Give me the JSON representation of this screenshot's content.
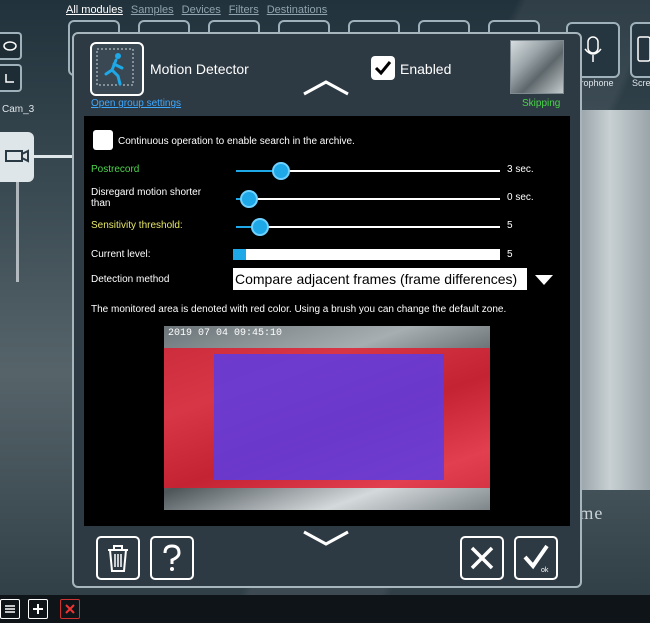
{
  "top_nav": [
    {
      "label": "All modules",
      "active": true
    },
    {
      "label": "Samples",
      "active": false
    },
    {
      "label": "Devices",
      "active": false
    },
    {
      "label": "Filters",
      "active": false
    },
    {
      "label": "Destinations",
      "active": false
    }
  ],
  "background": {
    "camera_label": "Cam_3",
    "right_tile_labels": [
      "icrophone",
      "Scre"
    ],
    "watermark": "IP   Z Came"
  },
  "dialog": {
    "title": "Motion Detector",
    "group_link": "Open group settings",
    "enabled_label": "Enabled",
    "enabled": true,
    "preview_status": "Skipping",
    "continuous_label": "Continuous operation to enable search in the archive.",
    "continuous_checked": false,
    "postrecord": {
      "label": "Postrecord",
      "value_text": "3 sec.",
      "fraction": 0.17
    },
    "disregard": {
      "label_line1": "Disregard motion shorter",
      "label_line2": "than",
      "value_text": "0 sec.",
      "fraction": 0.05
    },
    "sensitivity": {
      "label": "Sensitivity threshold:",
      "value_text": "5",
      "fraction": 0.09
    },
    "current_level": {
      "label": "Current level:",
      "value_text": "5",
      "fraction": 0.05
    },
    "detection_method": {
      "label": "Detection method",
      "selected": "Compare adjacent frames (frame differences)"
    },
    "zone_note": "The monitored area is denoted with red color. Using a brush you can change the default zone.",
    "zone_timestamp": "2019 07 04 09:45:10",
    "footer": {
      "delete_icon": "trash-icon",
      "help_icon": "help-icon",
      "cancel_icon": "close-icon",
      "ok_icon": "check-icon",
      "ok_label": "ok"
    }
  },
  "colors": {
    "accent": "#1ea8e8",
    "green": "#4fd44f",
    "yellow": "#e6e66a",
    "link": "#3fa9ff"
  }
}
